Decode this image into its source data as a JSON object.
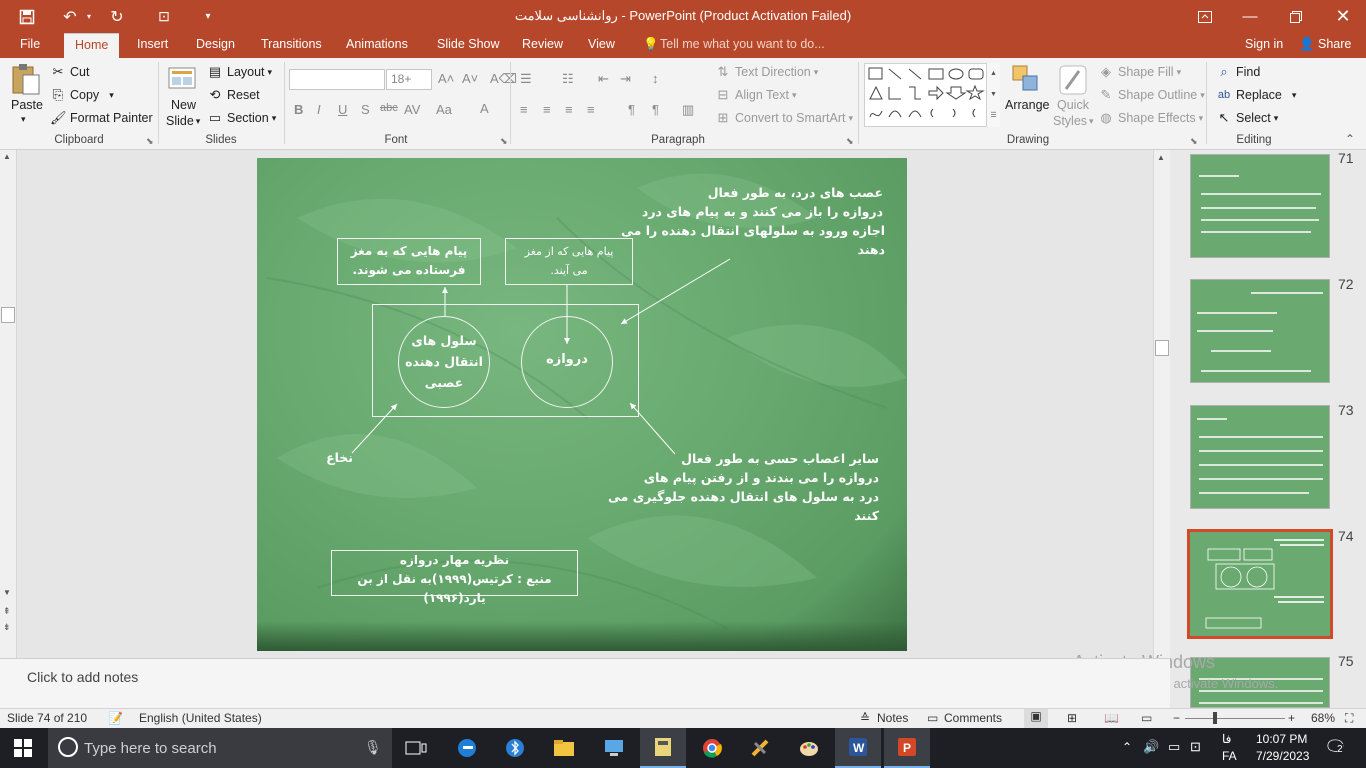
{
  "window": {
    "title": "روانشناسی سلامت - PowerPoint (Product Activation Failed)",
    "sign_in": "Sign in",
    "share": "Share",
    "tell_me": "Tell me what you want to do..."
  },
  "tabs": [
    "File",
    "Home",
    "Insert",
    "Design",
    "Transitions",
    "Animations",
    "Slide Show",
    "Review",
    "View"
  ],
  "ribbon": {
    "clipboard": {
      "label": "Clipboard",
      "paste": "Paste",
      "cut": "Cut",
      "copy": "Copy",
      "format_painter": "Format Painter"
    },
    "slides": {
      "label": "Slides",
      "new_slide_1": "New",
      "new_slide_2": "Slide",
      "layout": "Layout",
      "reset": "Reset",
      "section": "Section"
    },
    "font": {
      "label": "Font",
      "font_name": "",
      "font_size": "18+"
    },
    "paragraph": {
      "label": "Paragraph",
      "text_direction": "Text Direction",
      "align_text": "Align Text",
      "convert_smartart": "Convert to SmartArt"
    },
    "drawing": {
      "label": "Drawing",
      "arrange": "Arrange",
      "quick_styles_1": "Quick",
      "quick_styles_2": "Styles",
      "shape_fill": "Shape Fill",
      "shape_outline": "Shape Outline",
      "shape_effects": "Shape Effects"
    },
    "editing": {
      "label": "Editing",
      "find": "Find",
      "replace": "Replace",
      "select": "Select"
    }
  },
  "slide": {
    "top_text_1": "عصب های درد، به طور فعال",
    "top_text_2": "دروازه را باز می کنند و به پیام های درد",
    "top_text_3": "اجازه ورود به سلولهای انتقال دهنده  را می دهند",
    "box_left_1": "پیام هایی که به مغز",
    "box_left_2": "فرستاده می شوند.",
    "box_right_1": "پیام هایی که از مغز",
    "box_right_2": "می آیند.",
    "circle_left_1": "سلول های",
    "circle_left_2": "انتقال دهنده",
    "circle_left_3": "عصبی",
    "circle_right": "دروازه",
    "spinal": "نخاع",
    "bottom_text_1": "سایر اعصاب حسی به طور فعال",
    "bottom_text_2": "دروازه را می بندند و از رفتن پیام های",
    "bottom_text_3": "درد به سلول های انتقال دهنده جلوگیری می کنند",
    "caption_1": "نظریه مهار دروازه",
    "caption_2": "منبع : کرتیس(۱۹۹۹)به نقل از بن یارد(۱۹۹۶)"
  },
  "thumbnails": [
    {
      "number": "71"
    },
    {
      "number": "72"
    },
    {
      "number": "73"
    },
    {
      "number": "74",
      "selected": true
    },
    {
      "number": "75"
    }
  ],
  "notes_placeholder": "Click to add notes",
  "watermark": {
    "line1": "Activate Windows",
    "line2": "Go to Settings to activate Windows."
  },
  "status": {
    "slide_info": "Slide 74 of 210",
    "language": "English (United States)",
    "notes": "Notes",
    "comments": "Comments",
    "zoom": "68%"
  },
  "taskbar": {
    "search_placeholder": "Type here to search",
    "time": "10:07 PM",
    "date": "7/29/2023",
    "lang": "فا",
    "lang2": "FA",
    "notif_count": "2"
  },
  "colors": {
    "accent": "#b7472a",
    "slide_green": "#67a96f",
    "selected_thumb": "#d24a27"
  }
}
